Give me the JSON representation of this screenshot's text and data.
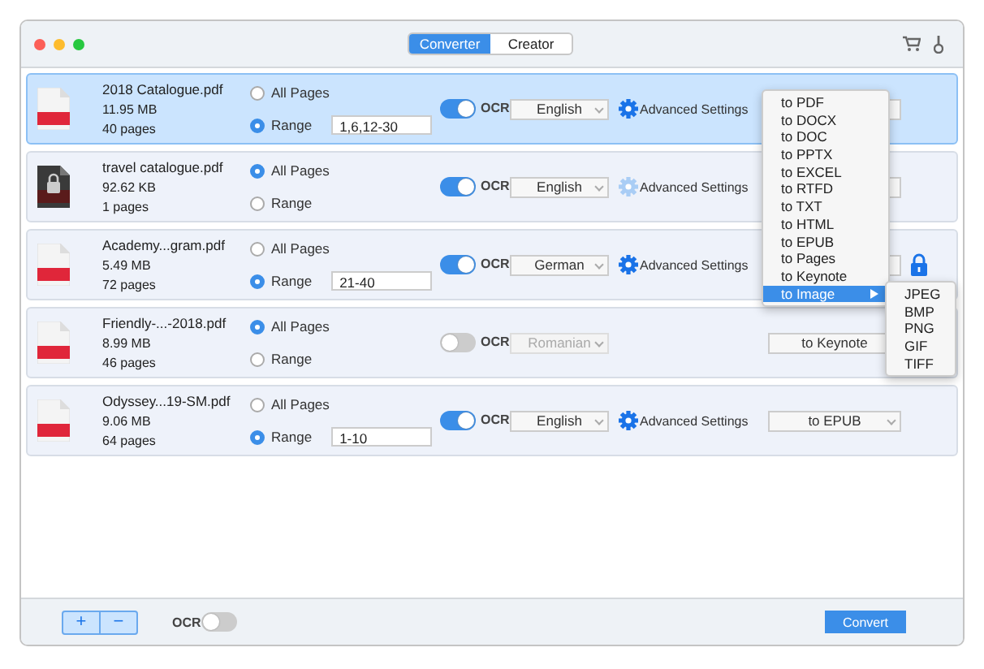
{
  "window": {
    "tabs": [
      {
        "label": "Converter",
        "selected": true
      },
      {
        "label": "Creator",
        "selected": false
      }
    ]
  },
  "files": [
    {
      "name": "2018 Catalogue.pdf",
      "size": "11.95 MB",
      "pages": "40 pages",
      "selected": true,
      "locked": false,
      "all_pages": {
        "label": "All Pages",
        "selected": false
      },
      "range": {
        "label": "Range",
        "selected": true,
        "value": "1,6,12-30"
      },
      "ocr": {
        "label": "OCR",
        "on": true
      },
      "language": {
        "value": "English",
        "disabled": false
      },
      "advanced": {
        "label": "Advanced Settings",
        "disabled": false
      },
      "protected": false
    },
    {
      "name": "travel catalogue.pdf",
      "size": "92.62 KB",
      "pages": "1 pages",
      "selected": false,
      "locked": true,
      "all_pages": {
        "label": "All Pages",
        "selected": true
      },
      "range": {
        "label": "Range",
        "selected": false
      },
      "ocr": {
        "label": "OCR",
        "on": true
      },
      "language": {
        "value": "English",
        "disabled": false
      },
      "advanced": {
        "label": "Advanced Settings",
        "disabled": true
      },
      "protected": false
    },
    {
      "name": "Academy...gram.pdf",
      "size": "5.49 MB",
      "pages": "72 pages",
      "selected": false,
      "locked": false,
      "all_pages": {
        "label": "All Pages",
        "selected": false
      },
      "range": {
        "label": "Range",
        "selected": true,
        "value": "21-40"
      },
      "ocr": {
        "label": "OCR",
        "on": true
      },
      "language": {
        "value": "German",
        "disabled": false
      },
      "advanced": {
        "label": "Advanced Settings",
        "disabled": false
      },
      "protected": true
    },
    {
      "name": "Friendly-...-2018.pdf",
      "size": "8.99 MB",
      "pages": "46 pages",
      "selected": false,
      "locked": false,
      "all_pages": {
        "label": "All Pages",
        "selected": true
      },
      "range": {
        "label": "Range",
        "selected": false
      },
      "ocr": {
        "label": "OCR",
        "on": false
      },
      "language": {
        "value": "Romanian",
        "disabled": true
      },
      "format": "to Keynote",
      "protected": false
    },
    {
      "name": "Odyssey...19-SM.pdf",
      "size": "9.06 MB",
      "pages": "64 pages",
      "selected": false,
      "locked": false,
      "all_pages": {
        "label": "All Pages",
        "selected": false
      },
      "range": {
        "label": "Range",
        "selected": true,
        "value": "1-10"
      },
      "ocr": {
        "label": "OCR",
        "on": true
      },
      "language": {
        "value": "English",
        "disabled": false
      },
      "advanced": {
        "label": "Advanced Settings",
        "disabled": false
      },
      "format": "to EPUB",
      "protected": false
    }
  ],
  "format_menu": {
    "items": [
      {
        "label": "to PDF",
        "selected": false,
        "submenu": false
      },
      {
        "label": "to DOCX",
        "selected": false,
        "submenu": false
      },
      {
        "label": "to DOC",
        "selected": false,
        "submenu": false
      },
      {
        "label": "to PPTX",
        "selected": false,
        "submenu": false
      },
      {
        "label": "to EXCEL",
        "selected": false,
        "submenu": false
      },
      {
        "label": "to RTFD",
        "selected": false,
        "submenu": false
      },
      {
        "label": "to TXT",
        "selected": false,
        "submenu": false
      },
      {
        "label": "to HTML",
        "selected": false,
        "submenu": false
      },
      {
        "label": "to EPUB",
        "selected": false,
        "submenu": false
      },
      {
        "label": "to Pages",
        "selected": false,
        "submenu": false
      },
      {
        "label": "to Keynote",
        "selected": false,
        "submenu": false
      },
      {
        "label": "to Image",
        "selected": true,
        "submenu": true
      }
    ],
    "submenu": [
      "JPEG",
      "BMP",
      "PNG",
      "GIF",
      "TIFF"
    ]
  },
  "footer": {
    "add": "+",
    "remove": "−",
    "ocr": {
      "label": "OCR",
      "on": false
    },
    "convert": "Convert"
  }
}
